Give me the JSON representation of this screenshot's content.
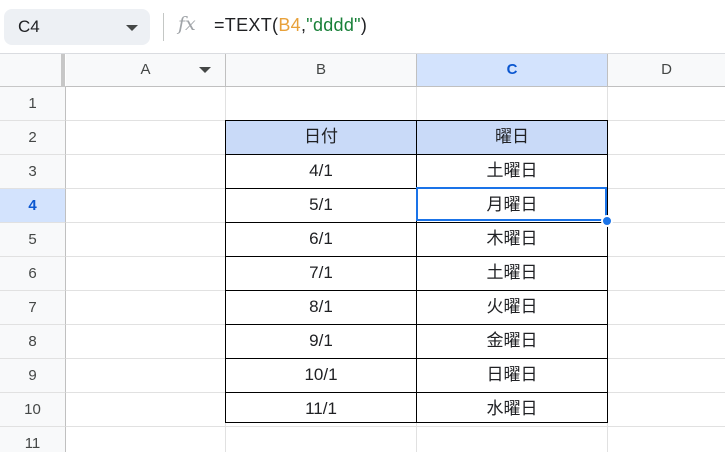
{
  "formula_bar": {
    "name_box": "C4",
    "fx_label": "fx",
    "formula_prefix": "=TEXT(",
    "formula_ref": "B4",
    "formula_comma": ",",
    "formula_string": "\"dddd\"",
    "formula_suffix": ")"
  },
  "columns": [
    "A",
    "B",
    "C",
    "D"
  ],
  "rows": [
    "1",
    "2",
    "3",
    "4",
    "5",
    "6",
    "7",
    "8",
    "9",
    "10",
    "11"
  ],
  "table": {
    "headers": [
      "日付",
      "曜日"
    ],
    "rows": [
      [
        "4/1",
        "土曜日"
      ],
      [
        "5/1",
        "月曜日"
      ],
      [
        "6/1",
        "木曜日"
      ],
      [
        "7/1",
        "土曜日"
      ],
      [
        "8/1",
        "火曜日"
      ],
      [
        "9/1",
        "金曜日"
      ],
      [
        "10/1",
        "日曜日"
      ],
      [
        "11/1",
        "水曜日"
      ]
    ]
  },
  "colors": {
    "selection": "#1a73e8",
    "header_fill": "#c9daf8",
    "selected_header": "#d3e3fd"
  }
}
